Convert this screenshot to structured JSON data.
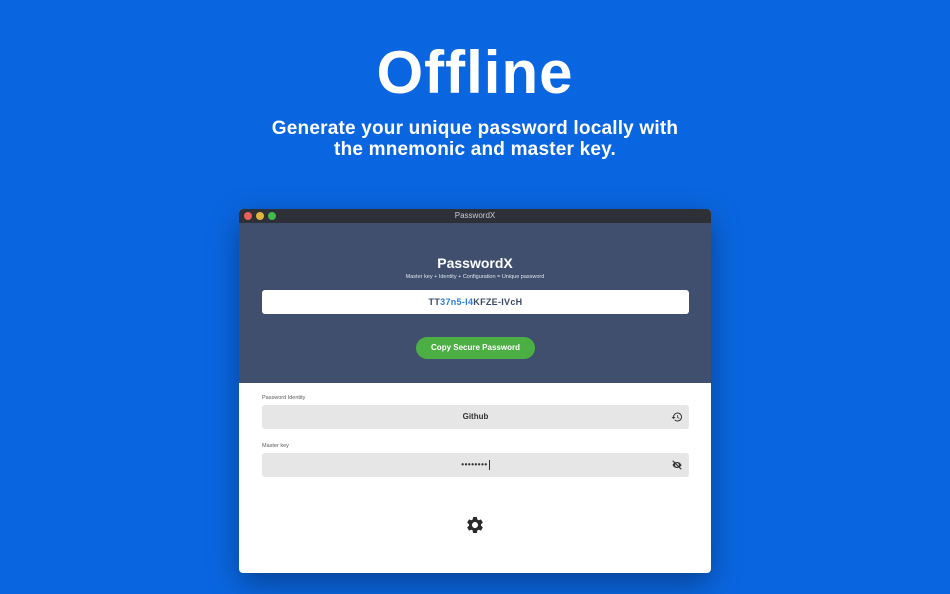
{
  "hero": {
    "title": "Offline",
    "subtitle_line1": "Generate your unique password locally with",
    "subtitle_line2": "the mnemonic and master key."
  },
  "window": {
    "title": "PasswordX"
  },
  "header": {
    "app_name": "PasswordX",
    "tagline": "Master key + Identity + Configuration = Unique password"
  },
  "password": {
    "segments": [
      "TT",
      "37n5-I4",
      "KFZE-IVcH"
    ],
    "value": "TT37n5-I4KFZE-IVcH"
  },
  "actions": {
    "copy_label": "Copy Secure Password"
  },
  "form": {
    "identity_label": "Password Identity",
    "identity_value": "Github",
    "master_label": "Master key",
    "master_value": "••••••••"
  },
  "icons": {
    "history": "history-icon",
    "visibility": "eye-off-icon",
    "settings": "gear-icon"
  },
  "colors": {
    "background": "#0a66e0",
    "header_panel": "#3f4f6d",
    "accent_green": "#4caf43",
    "password_blue": "#2a7ed8"
  }
}
